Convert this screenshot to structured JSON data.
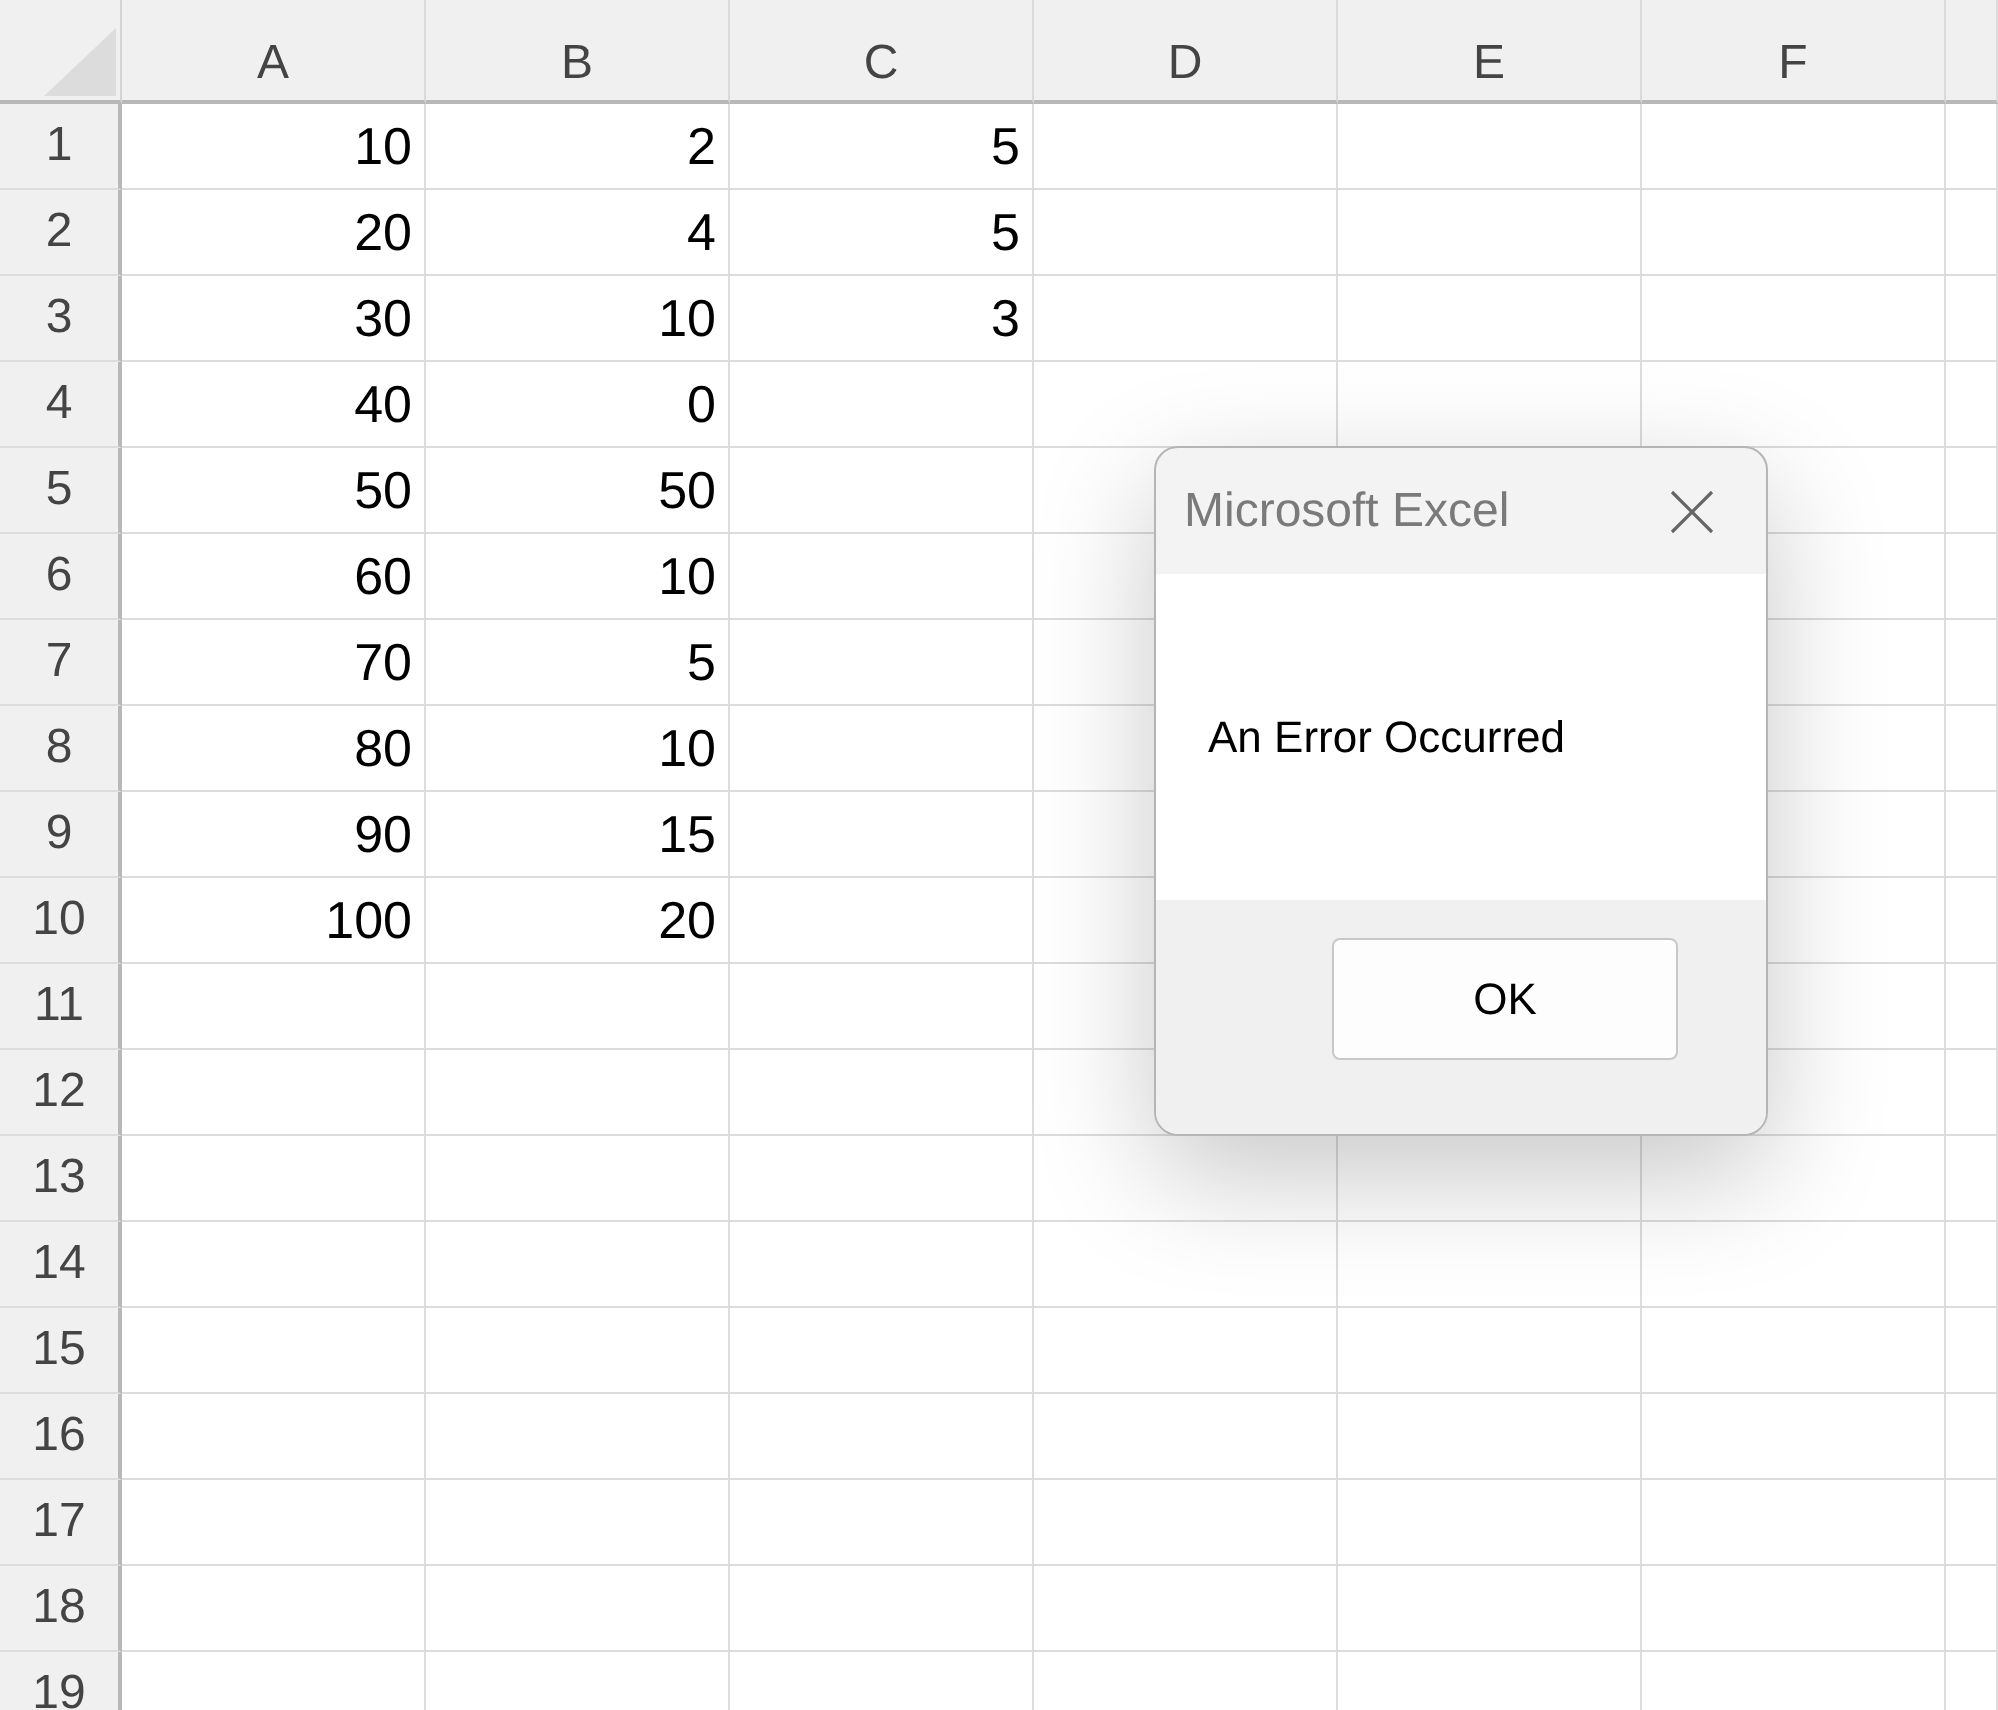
{
  "sheet": {
    "columns": [
      "A",
      "B",
      "C",
      "D",
      "E",
      "F"
    ],
    "rows": [
      {
        "header": "1",
        "cells": [
          "10",
          "2",
          "5"
        ]
      },
      {
        "header": "2",
        "cells": [
          "20",
          "4",
          "5"
        ]
      },
      {
        "header": "3",
        "cells": [
          "30",
          "10",
          "3"
        ]
      },
      {
        "header": "4",
        "cells": [
          "40",
          "0"
        ]
      },
      {
        "header": "5",
        "cells": [
          "50",
          "50"
        ]
      },
      {
        "header": "6",
        "cells": [
          "60",
          "10"
        ]
      },
      {
        "header": "7",
        "cells": [
          "70",
          "5"
        ]
      },
      {
        "header": "8",
        "cells": [
          "80",
          "10"
        ]
      },
      {
        "header": "9",
        "cells": [
          "90",
          "15"
        ]
      },
      {
        "header": "10",
        "cells": [
          "100",
          "20"
        ]
      },
      {
        "header": "11"
      },
      {
        "header": "12"
      },
      {
        "header": "13"
      },
      {
        "header": "14"
      },
      {
        "header": "15"
      },
      {
        "header": "16"
      },
      {
        "header": "17"
      },
      {
        "header": "18"
      },
      {
        "header": "19"
      }
    ]
  },
  "dialog": {
    "title": "Microsoft Excel",
    "message": "An Error Occurred",
    "buttons": [
      "OK"
    ]
  }
}
